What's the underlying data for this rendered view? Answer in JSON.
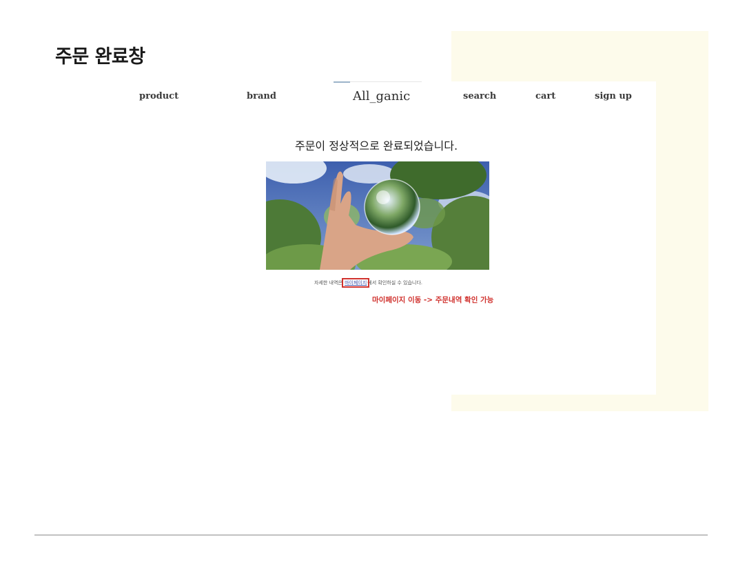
{
  "slide": {
    "title": "주문 완료창"
  },
  "nav": {
    "items": [
      {
        "key": "product",
        "label": "product"
      },
      {
        "key": "brand",
        "label": "brand"
      },
      {
        "key": "search",
        "label": "search"
      },
      {
        "key": "cart",
        "label": "cart"
      },
      {
        "key": "signup",
        "label": "sign up"
      }
    ],
    "brand": "All_ganic"
  },
  "main": {
    "headline": "주문이 정상적으로 완료되었습니다.",
    "info_before": "자세한 내역은 ",
    "info_link": "마이페이지",
    "info_after": "에서 확인하실 수 있습니다.",
    "annotation": "마이페이지 이동 -> 주문내역 확인 가능"
  },
  "colors": {
    "accent_red": "#d0312d",
    "deco_bg": "#fdfbeb"
  }
}
